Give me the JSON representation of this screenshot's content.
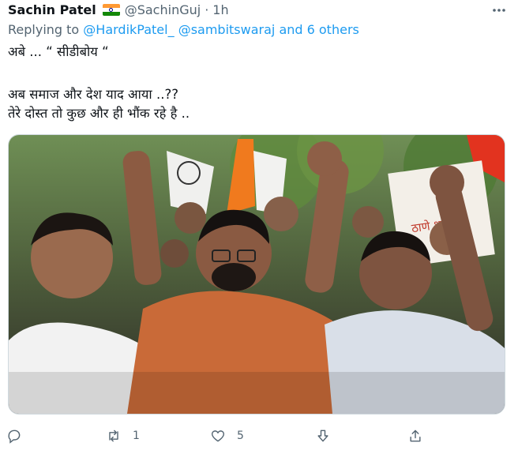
{
  "tweet": {
    "display_name": "Sachin Patel",
    "handle": "@SachinGuj",
    "separator": "·",
    "time": "1h",
    "replying_prefix": "Replying to",
    "reply_to_1": "@HardikPatel_",
    "reply_to_2": "@sambitswaraj",
    "reply_to_suffix": "and 6 others",
    "lines": [
      "अबे ... “ सीडीबोय “",
      "अब समाज और देश याद आया ..??",
      "तेरे दोस्त तो कुछ और ही भौंक रहे है .."
    ],
    "media_text": "ठाणे शहर"
  },
  "actions": {
    "reply_count": "",
    "retweet_count": "1",
    "like_count": "5"
  },
  "icons": {
    "flag": "india-flag-icon",
    "more": "more-icon",
    "reply": "reply-icon",
    "retweet": "retweet-icon",
    "like": "like-icon",
    "downvote": "downvote-icon",
    "share": "share-icon"
  },
  "colors": {
    "link": "#1d9bf0",
    "secondary": "#536471",
    "text": "#0f1419"
  }
}
